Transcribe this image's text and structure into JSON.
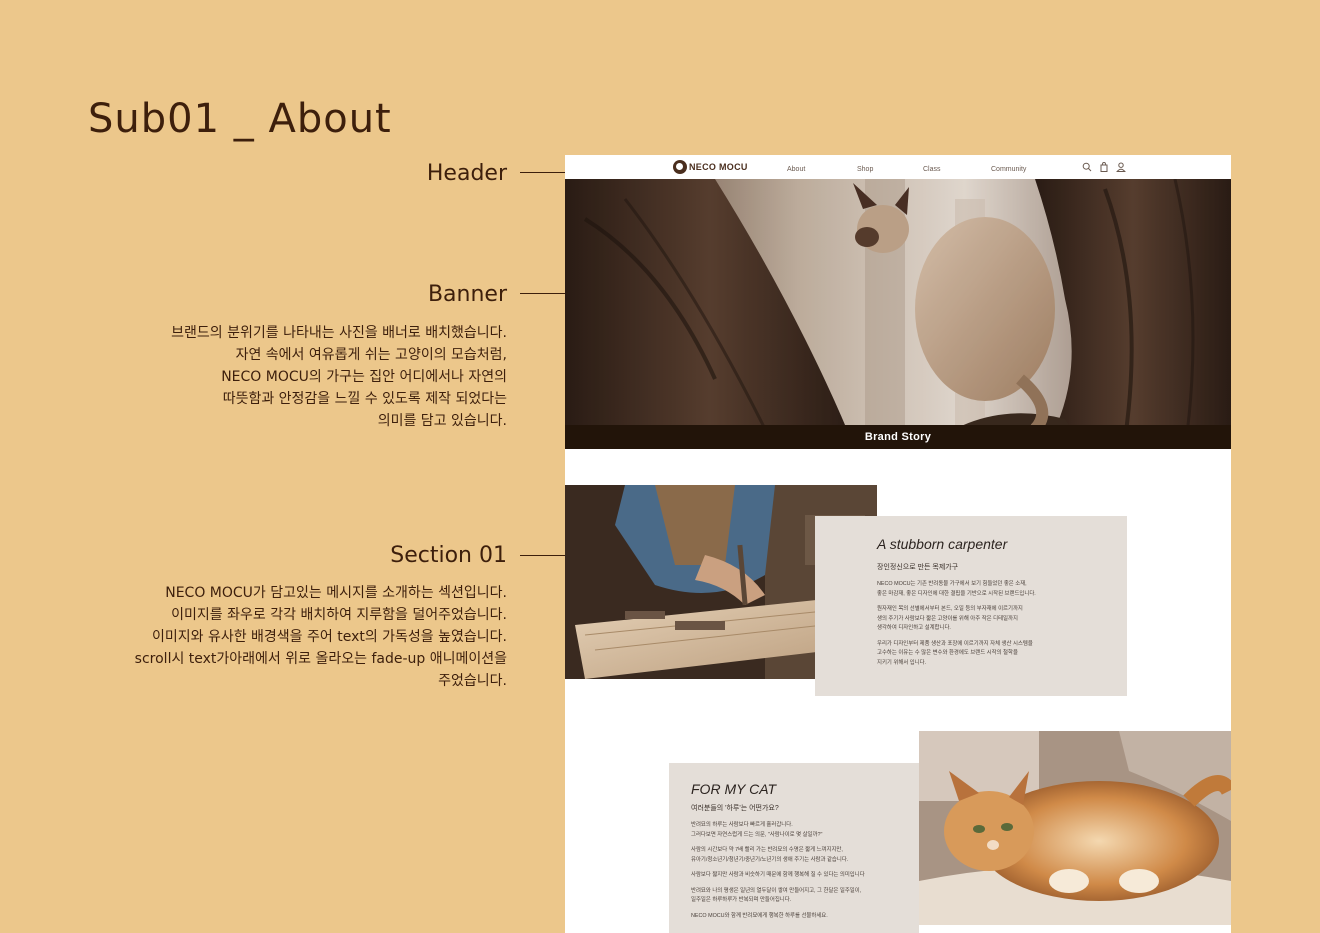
{
  "page_title": "Sub01 _ About",
  "annotations": {
    "header": {
      "label": "Header"
    },
    "banner": {
      "label": "Banner",
      "description": [
        "브랜드의 분위기를 나타내는 사진을 배너로 배치했습니다.",
        "자연 속에서 여유롭게 쉬는 고양이의 모습처럼,",
        "NECO MOCU의 가구는 집안 어디에서나 자연의",
        "따뜻함과 안정감을 느낄 수 있도록 제작 되었다는",
        "의미를 담고 있습니다."
      ]
    },
    "section01": {
      "label": "Section 01",
      "description": [
        "NECO MOCU가 담고있는 메시지를 소개하는 섹션입니다.",
        "이미지를 좌우로 각각 배치하여 지루함을 덜어주었습니다.",
        "이미지와 유사한 배경색을 주어 text의 가독성을 높였습니다.",
        "scroll시 text가아래에서 위로 올라오는 fade-up 애니메이션을",
        "주었습니다."
      ]
    }
  },
  "site": {
    "logo_text": "NECO MOCU",
    "nav": [
      "About",
      "Shop",
      "Class",
      "Community"
    ],
    "header_icons": [
      "search-icon",
      "cart-icon",
      "user-icon"
    ],
    "banner_caption": "Brand Story",
    "section1": {
      "title": "A stubborn carpenter",
      "subtitle": "장인정신으로 만든 목제가구",
      "paragraphs": [
        [
          "NECO MOCU는 기존 반려동물 가구에서 보기 힘들었던 좋은 소재,",
          "좋은 마감재, 좋은 디자인에 대한 결핍을 기반으로 시작된 브랜드입니다."
        ],
        [
          "원자재인 목의 선별에서부터 본드, 오일 등의 부자재에 이르기까지",
          "생의 주기가 사람보다 짧은 고양이를 위해 아주 작은 디테일까지",
          "생각하여 디자인하고 설계합니다."
        ],
        [
          "우리가 디자인부터 제품 생산과 포장에 이르기까지 자체 생산 시스템을",
          "고수하는 이유는 수 많은 변수와 환경에도 브랜드 시작의 철학을",
          "지키기 위해서 입니다."
        ]
      ]
    },
    "section2": {
      "title": "FOR MY CAT",
      "subtitle": "여러분들의 '하루'는 어떤가요?",
      "paragraphs": [
        [
          "반려묘의 하루는 사람보다 빠르게 흘러갑니다.",
          "그러다보면 자연스럽게 드는 의문, \"사람나이로 몇 살일까?\""
        ],
        [
          "사람의 시간보다 약 7배 빨리 가는 반려묘의 수명은 짧게 느껴지지만,",
          "유아기/청소년기/청년기/중년기/노년기의 생애 주기는 사람과 같습니다."
        ],
        [
          "사람보다 짧지만 사람과 비슷하기 때문에 함께 행복해 질 수 있다는 의미입니다"
        ],
        [
          "반려묘와 나의 평생은 일년의 열두달이 쌓여 만들어지고, 그 한달은 일주일이,",
          "일주일은 하루하루가 반복되며 만들어집니다."
        ],
        [
          "NECO MOCU와 함께 반려묘에게 행복한 하루를 선물하세요."
        ]
      ]
    }
  }
}
